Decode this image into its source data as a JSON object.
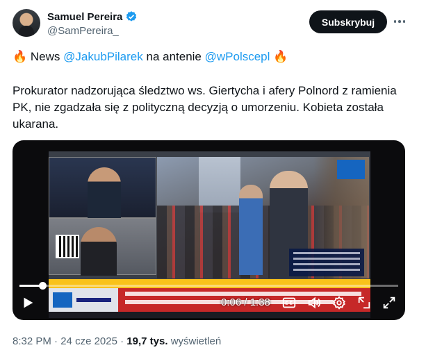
{
  "author": {
    "name": "Samuel Pereira",
    "handle": "@SamPereira_",
    "verified_color": "#1d9bf0"
  },
  "header": {
    "subscribe_label": "Subskrybuj",
    "more_icon": "ellipsis-icon"
  },
  "tweet": {
    "line1": {
      "emoji_left": "🔥",
      "word1": "News",
      "mention1": "@JakubPilarek",
      "word2": "na antenie",
      "mention2": "@wPolscepl",
      "emoji_right": "🔥"
    },
    "body": "Prokurator nadzorująca śledztwo ws. Giertycha i afery Polnord z ramienia PK, nie zgadzała się z polityczną decyzją o umorzeniu. Kobieta została ukarana."
  },
  "video": {
    "time_display": "0:06 / 1:38",
    "progress_fraction": 0.061,
    "controls": [
      "play-icon",
      "captions-icon",
      "volume-icon",
      "settings-icon",
      "pip-icon",
      "fullscreen-icon"
    ]
  },
  "meta": {
    "time": "8:32 PM",
    "separator": "·",
    "date": "24 cze 2025",
    "views_count": "19,7 tys.",
    "views_label": "wyświetleń"
  },
  "colors": {
    "link": "#1d9bf0",
    "text": "#0f1419",
    "secondary": "#536471",
    "button_bg": "#0f1419"
  }
}
